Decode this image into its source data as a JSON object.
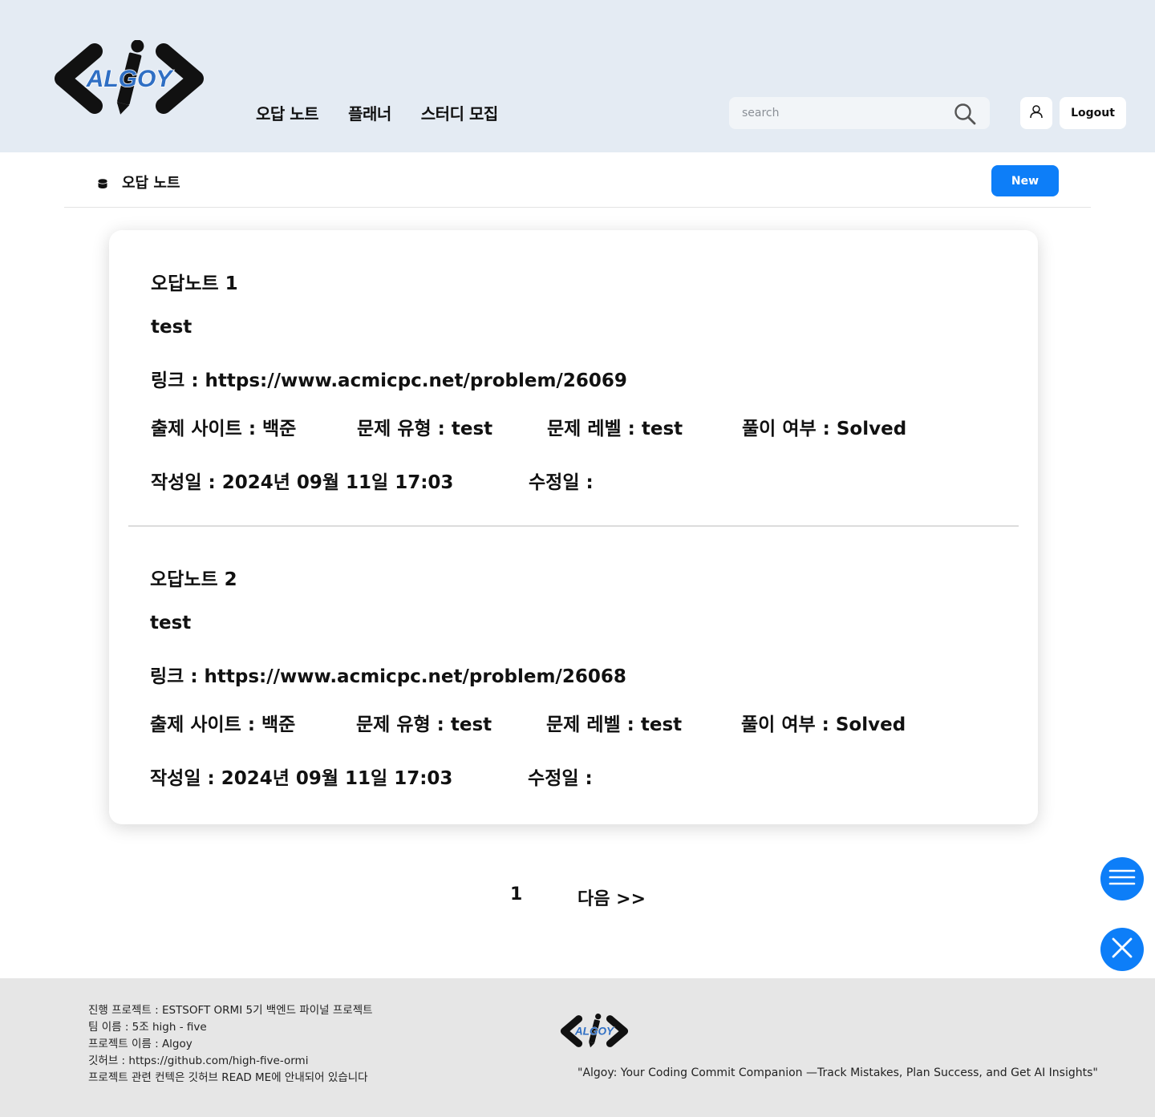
{
  "header": {
    "logo_text": "ALGOY",
    "nav": [
      {
        "label": "오답 노트"
      },
      {
        "label": "플래너"
      },
      {
        "label": "스터디 모집"
      }
    ],
    "search": {
      "placeholder": "search",
      "value": ""
    },
    "logout_label": "Logout",
    "icons": {
      "search": "search-icon",
      "user": "user-icon"
    }
  },
  "subbar": {
    "title": "오답 노트",
    "new_label": "New",
    "icon": "database-icon"
  },
  "notes": [
    {
      "title": "오답노트 1",
      "subtitle": "test",
      "link": "링크 : https://www.acmicpc.net/problem/26069",
      "site": "출제 사이트 : 백준",
      "type": "문제 유형 : test",
      "level": "문제 레벨 :  test",
      "solved": "풀이 여부 : Solved",
      "created": "작성일 : 2024년 09월 11일 17:03",
      "modified": "수정일 :"
    },
    {
      "title": "오답노트 2",
      "subtitle": "test",
      "link": "링크 : https://www.acmicpc.net/problem/26068",
      "site": "출제 사이트 : 백준",
      "type": "문제 유형 : test",
      "level": "문제 레벨 :  test",
      "solved": "풀이 여부 : Solved",
      "created": "작성일 : 2024년 09월 11일 17:03",
      "modified": "수정일 :"
    }
  ],
  "pagination": {
    "current": "1",
    "next": "다음 >>"
  },
  "fabs": {
    "menu_icon": "menu-icon",
    "close_icon": "close-icon"
  },
  "footer": {
    "lines": [
      "진행 프로젝트 : ESTSOFT ORMI 5기 백엔드 파이널 프로젝트",
      "팀 이름 : 5조 high - five",
      "프로젝트 이름 : Algoy",
      "깃허브 : https://github.com/high-five-ormi",
      "프로젝트 관련 컨텍은 깃허브 READ ME에 안내되어 있습니다"
    ],
    "logo_text": "ALGOY",
    "slogan": "\"Algoy: Your Coding Commit Companion —Track Mistakes, Plan Success, and Get AI Insights\""
  },
  "colors": {
    "header_bg": "#e4ebf3",
    "accent": "#0d7ef8",
    "footer_bg": "#e6e6e6",
    "logo_blue": "#2f6fc4"
  }
}
